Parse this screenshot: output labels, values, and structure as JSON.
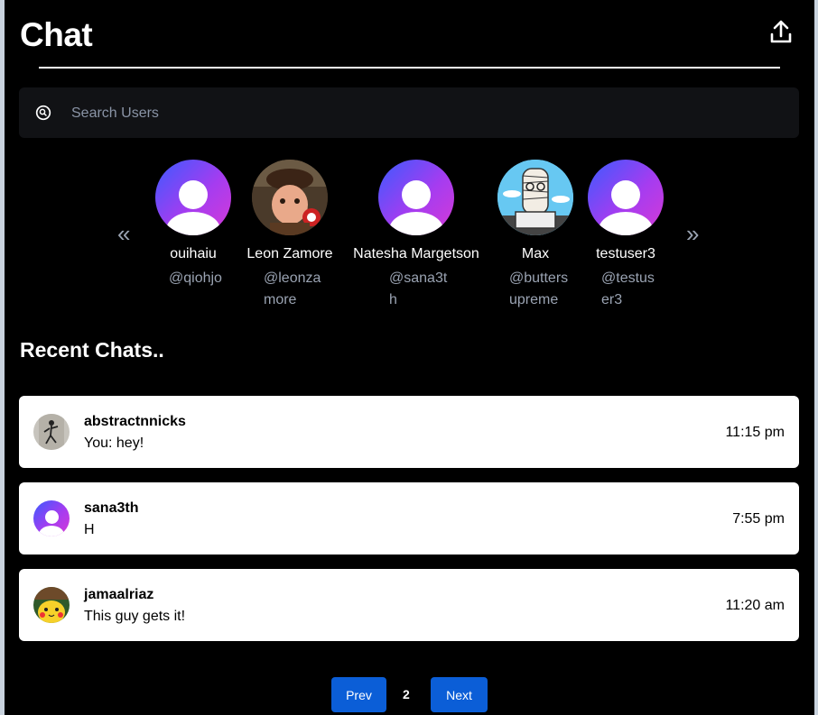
{
  "header": {
    "title": "Chat",
    "upload_icon": "upload-icon"
  },
  "search": {
    "placeholder": "Search Users",
    "value": "",
    "icon": "search-icon"
  },
  "carousel": {
    "prev_icon": "«",
    "next_icon": "»",
    "users": [
      {
        "name": "ouihaiu",
        "handle": "@qiohjo",
        "avatar": "default"
      },
      {
        "name": "Leon Zamore",
        "handle": "@leonzamore",
        "avatar": "photo-clown"
      },
      {
        "name": "Natesha Margetson",
        "handle": "@sana3th",
        "avatar": "default"
      },
      {
        "name": "Max",
        "handle": "@buttersupreme",
        "avatar": "cartoon-bandaged"
      },
      {
        "name": "testuser3",
        "handle": "@testuser3",
        "avatar": "default"
      }
    ]
  },
  "recent": {
    "title": "Recent Chats..",
    "chats": [
      {
        "name": "abstractnnicks",
        "message": "You: hey!",
        "time": "11:15 pm",
        "avatar": "photo-figure"
      },
      {
        "name": "sana3th",
        "message": "H",
        "time": "7:55 pm",
        "avatar": "default"
      },
      {
        "name": "jamaalriaz",
        "message": "This guy gets it!",
        "time": "11:20 am",
        "avatar": "pikachu"
      }
    ]
  },
  "pagination": {
    "prev_label": "Prev",
    "page": "2",
    "next_label": "Next"
  },
  "colors": {
    "accent": "#0b5ed7",
    "background": "#000000",
    "card": "#ffffff",
    "muted": "#9aa3b2"
  }
}
